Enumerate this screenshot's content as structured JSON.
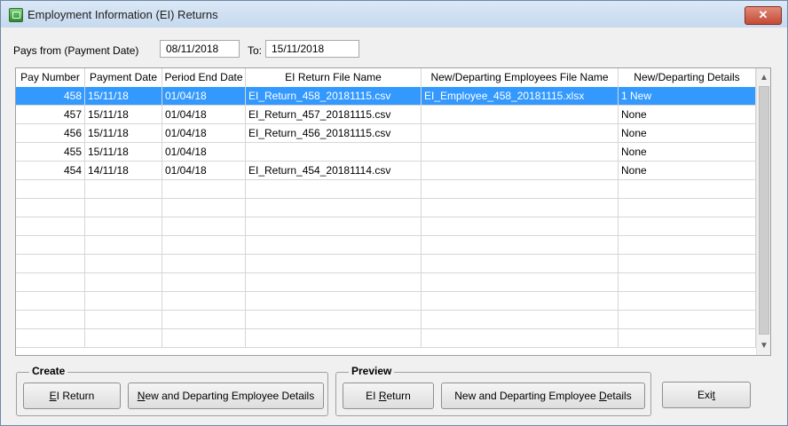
{
  "window": {
    "title": "Employment Information (EI) Returns",
    "close_glyph": "✕"
  },
  "filter": {
    "from_label": "Pays from (Payment Date)",
    "from_value": "08/11/2018",
    "to_label": "To:",
    "to_value": "15/11/2018"
  },
  "table": {
    "columns": [
      "Pay Number",
      "Payment Date",
      "Period End Date",
      "EI Return File Name",
      "New/Departing Employees File Name",
      "New/Departing Details"
    ],
    "rows": [
      [
        "458",
        "15/11/18",
        "01/04/18",
        "EI_Return_458_20181115.csv",
        "EI_Employee_458_20181115.xlsx",
        "1 New"
      ],
      [
        "457",
        "15/11/18",
        "01/04/18",
        "EI_Return_457_20181115.csv",
        "",
        "None"
      ],
      [
        "456",
        "15/11/18",
        "01/04/18",
        "EI_Return_456_20181115.csv",
        "",
        "None"
      ],
      [
        "455",
        "15/11/18",
        "01/04/18",
        "",
        "",
        "None"
      ],
      [
        "454",
        "14/11/18",
        "01/04/18",
        "EI_Return_454_20181114.csv",
        "",
        "None"
      ]
    ],
    "selected_row": 0,
    "scroll_up_glyph": "▲",
    "scroll_down_glyph": "▼"
  },
  "create": {
    "title": "Create",
    "ei_return_accel": "E",
    "ei_return_rest": "I Return",
    "new_departing_accel": "N",
    "new_departing_rest": "ew and Departing Employee Details"
  },
  "preview": {
    "title": "Preview",
    "ei_return_before": "EI ",
    "ei_return_accel": "R",
    "ei_return_rest": "eturn",
    "new_departing_before": "New and  Departing  Employee ",
    "new_departing_accel": "D",
    "new_departing_rest": "etails"
  },
  "exit": {
    "before": "Exi",
    "accel": "t"
  }
}
